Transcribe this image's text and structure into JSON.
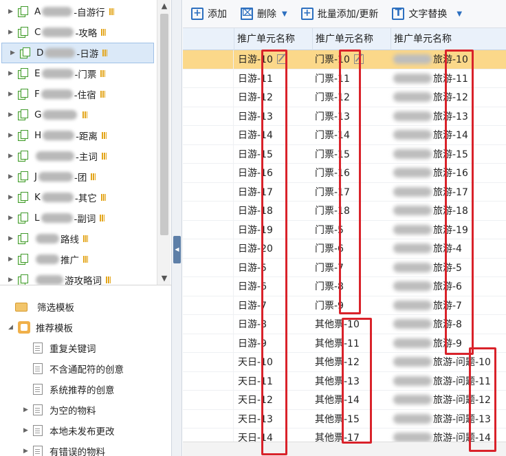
{
  "tree": {
    "items": [
      {
        "prefix": "A",
        "suffix": "-自游行",
        "blur_w": 44
      },
      {
        "prefix": "C",
        "suffix": "-攻略",
        "blur_w": 46
      },
      {
        "prefix": "D",
        "suffix": "-日游",
        "blur_w": 44,
        "selected": true
      },
      {
        "prefix": "E",
        "suffix": "-门票",
        "blur_w": 46
      },
      {
        "prefix": "F",
        "suffix": "-住宿",
        "blur_w": 46
      },
      {
        "prefix": "G",
        "suffix": "",
        "blur_w": 50
      },
      {
        "prefix": "H",
        "suffix": "-距离",
        "blur_w": 46
      },
      {
        "prefix": "",
        "suffix": "-主词",
        "blur_w": 56
      },
      {
        "prefix": "J",
        "suffix": "-团",
        "blur_w": 50
      },
      {
        "prefix": "K",
        "suffix": "-其它",
        "blur_w": 46
      },
      {
        "prefix": "L",
        "suffix": "-副词",
        "blur_w": 46
      },
      {
        "prefix": "",
        "suffix": "路线",
        "blur_w": 34
      },
      {
        "prefix": "",
        "suffix": "推广",
        "blur_w": 34
      },
      {
        "prefix": "",
        "suffix": "游攻略词",
        "blur_w": 40
      }
    ]
  },
  "filter": {
    "title": "筛选模板",
    "group": "推荐模板",
    "items": [
      {
        "label": "重复关键词",
        "kind": "doc"
      },
      {
        "label": "不含通配符的创意",
        "kind": "doc"
      },
      {
        "label": "系统推荐的创意",
        "kind": "doc"
      },
      {
        "label": "为空的物料",
        "kind": "doc-expand"
      },
      {
        "label": "本地未发布更改",
        "kind": "doc-expand"
      },
      {
        "label": "有错误的物料",
        "kind": "doc-expand"
      }
    ]
  },
  "toolbar": {
    "add": "添加",
    "delete": "删除",
    "bulk": "批量添加/更新",
    "replace": "文字替换"
  },
  "grid": {
    "columns": [
      "推广单元名称",
      "推广单元名称",
      "推广单元名称"
    ],
    "rows": [
      [
        "日游-10",
        "门票-10",
        "旅游-10"
      ],
      [
        "日游-11",
        "门票-11",
        "旅游-11"
      ],
      [
        "日游-12",
        "门票-12",
        "旅游-12"
      ],
      [
        "日游-13",
        "门票-13",
        "旅游-13"
      ],
      [
        "日游-14",
        "门票-14",
        "旅游-14"
      ],
      [
        "日游-15",
        "门票-15",
        "旅游-15"
      ],
      [
        "日游-16",
        "门票-16",
        "旅游-16"
      ],
      [
        "日游-17",
        "门票-17",
        "旅游-17"
      ],
      [
        "日游-18",
        "门票-18",
        "旅游-18"
      ],
      [
        "日游-19",
        "门票-5",
        "旅游-19"
      ],
      [
        "日游-20",
        "门票-6",
        "旅游-4"
      ],
      [
        "日游-5",
        "门票-7",
        "旅游-5"
      ],
      [
        "日游-6",
        "门票-8",
        "旅游-6"
      ],
      [
        "日游-7",
        "门票-9",
        "旅游-7"
      ],
      [
        "日游-8",
        "其他票-10",
        "旅游-8"
      ],
      [
        "日游-9",
        "其他票-11",
        "旅游-9"
      ],
      [
        "天日-10",
        "其他票-12",
        "旅游-问题-10"
      ],
      [
        "天日-11",
        "其他票-13",
        "旅游-问题-11"
      ],
      [
        "天日-12",
        "其他票-14",
        "旅游-问题-12"
      ],
      [
        "天日-13",
        "其他票-15",
        "旅游-问题-13"
      ],
      [
        "天日-14",
        "其他票-17",
        "旅游-问题-14"
      ]
    ]
  },
  "colors": {
    "selected_row": "#fbd88a",
    "annotation_red": "#d9222a",
    "accent_blue": "#2c6fbf"
  }
}
